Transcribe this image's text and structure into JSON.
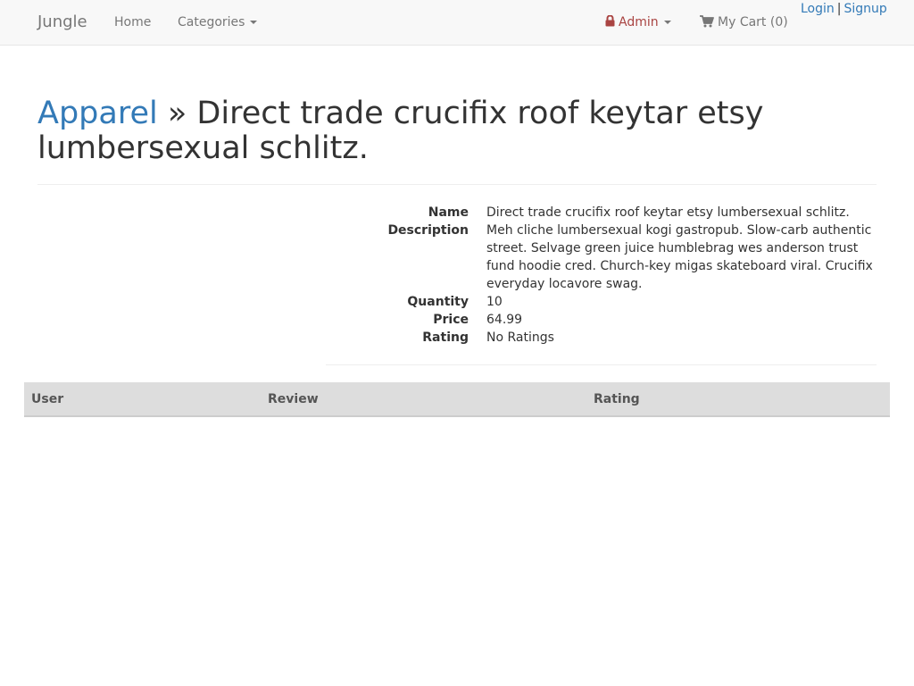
{
  "nav": {
    "brand": "Jungle",
    "home": "Home",
    "categories": "Categories",
    "admin": "Admin",
    "cart": "My Cart (0)",
    "login": "Login",
    "separator": "|",
    "signup": "Signup",
    "icons": {
      "admin": "lock-icon",
      "cart": "shopping-cart-icon"
    },
    "colors": {
      "admin": "#a94442",
      "link": "#337ab7"
    }
  },
  "header": {
    "category": "Apparel",
    "separator": "»",
    "title": "Direct trade crucifix roof keytar etsy lumbersexual schlitz."
  },
  "details": {
    "labels": {
      "name": "Name",
      "description": "Description",
      "quantity": "Quantity",
      "price": "Price",
      "rating": "Rating"
    },
    "values": {
      "name": "Direct trade crucifix roof keytar etsy lumbersexual schlitz.",
      "description": "Meh cliche lumbersexual kogi gastropub. Slow-carb authentic street. Selvage green juice humblebrag wes anderson trust fund hoodie cred. Church-key migas skateboard viral. Crucifix everyday locavore swag.",
      "quantity": "10",
      "price": "64.99",
      "rating": "No Ratings"
    }
  },
  "reviews": {
    "columns": [
      "User",
      "Review",
      "Rating"
    ],
    "rows": []
  }
}
